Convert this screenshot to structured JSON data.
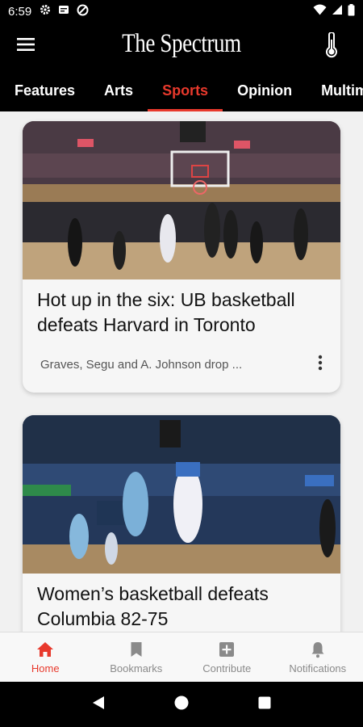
{
  "status_bar": {
    "time": "6:59"
  },
  "app": {
    "title": "The Spectrum"
  },
  "tabs": [
    {
      "label": "Features"
    },
    {
      "label": "Arts"
    },
    {
      "label": "Sports"
    },
    {
      "label": "Opinion"
    },
    {
      "label": "Multimedia"
    }
  ],
  "active_tab": "Sports",
  "articles": [
    {
      "headline": "Hot up in the six: UB basketball defeats Harvard in Toronto",
      "excerpt": "Graves, Segu and A. Johnson drop ..."
    },
    {
      "headline": "Women’s basketball defeats Columbia 82-75",
      "excerpt": ""
    }
  ],
  "bottom_nav": [
    {
      "label": "Home",
      "icon": "home-icon"
    },
    {
      "label": "Bookmarks",
      "icon": "bookmark-icon"
    },
    {
      "label": "Contribute",
      "icon": "plus-box-icon"
    },
    {
      "label": "Notifications",
      "icon": "bell-icon"
    }
  ],
  "colors": {
    "accent": "#e8392c",
    "bar": "#000000",
    "card": "#f6f6f6",
    "background": "#f1f1f1"
  }
}
